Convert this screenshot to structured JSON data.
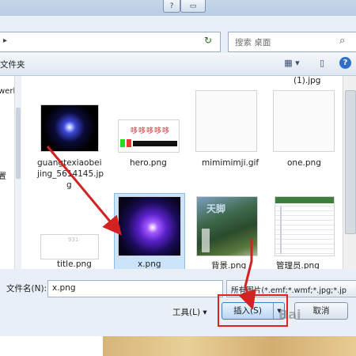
{
  "titlebar": {
    "help_glyph": "?",
    "maximize_glyph": "▭",
    "close_glyph": "✕"
  },
  "address": {
    "nav_glyph": "▸",
    "refresh_glyph": "↻"
  },
  "search": {
    "placeholder": "搜索 桌面",
    "icon": "search-icon"
  },
  "toolbar": {
    "breadcrumb": "文件夹",
    "view_glyph": "▦ ▾",
    "pane_glyph": "▯",
    "help_glyph": "?"
  },
  "nav_pane": {
    "items": [
      "werk",
      "置",
      "位置"
    ]
  },
  "files": [
    {
      "name": "(1).jpg"
    },
    {
      "name": "guangtexiaobeijing_5614145.jpg",
      "lines": [
        "guangtexiaobei",
        "jing_5614145.jp",
        "g"
      ]
    },
    {
      "name": "hero.png"
    },
    {
      "name": "mimimimji.gif"
    },
    {
      "name": "one.png"
    },
    {
      "name": "title.png"
    },
    {
      "name": "x.png",
      "selected": true
    },
    {
      "name": "背景.png"
    },
    {
      "name": "管理员.png"
    }
  ],
  "thumb_texts": {
    "hero": "哆哆哆哆哆",
    "title": "931",
    "bg_overlay": "天脚"
  },
  "bottom": {
    "filename_label": "文件名(N):",
    "filename_value": "x.png",
    "filter_value": "所有图片(*.emf;*.wmf;*.jpg;*.jp",
    "tools_label": "工具(L)",
    "tools_arrow": "▾",
    "insert_label": "插入(S)",
    "insert_split_glyph": "▾",
    "cancel_label": "取消"
  },
  "watermark": "Bai",
  "colors": {
    "accent_blue": "#2f6fc9",
    "selection": "#cce4fa",
    "annotation_red": "#d22222"
  }
}
